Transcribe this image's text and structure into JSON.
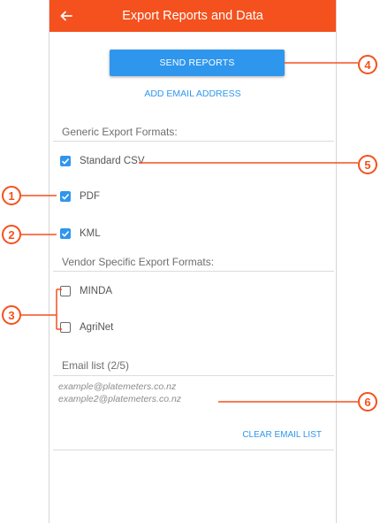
{
  "app_bar": {
    "title": "Export Reports and Data"
  },
  "actions": {
    "send_reports": "SEND REPORTS",
    "add_email": "ADD EMAIL ADDRESS",
    "clear_email_list": "CLEAR EMAIL LIST"
  },
  "generic_formats": {
    "header": "Generic Export Formats:",
    "items": [
      {
        "label": "Standard CSV",
        "checked": true
      },
      {
        "label": "PDF",
        "checked": true
      },
      {
        "label": "KML",
        "checked": true
      }
    ]
  },
  "vendor_formats": {
    "header": "Vendor Specific Export Formats:",
    "items": [
      {
        "label": "MINDA",
        "checked": false
      },
      {
        "label": "AgriNet",
        "checked": false
      }
    ]
  },
  "email_list": {
    "header": "Email list (2/5)",
    "emails": [
      "example@platemeters.co.nz",
      "example2@platemeters.co.nz"
    ]
  },
  "callouts": [
    "1",
    "2",
    "3",
    "4",
    "5",
    "6"
  ],
  "colors": {
    "accent": "#f4511e",
    "primary": "#2f96ee"
  }
}
